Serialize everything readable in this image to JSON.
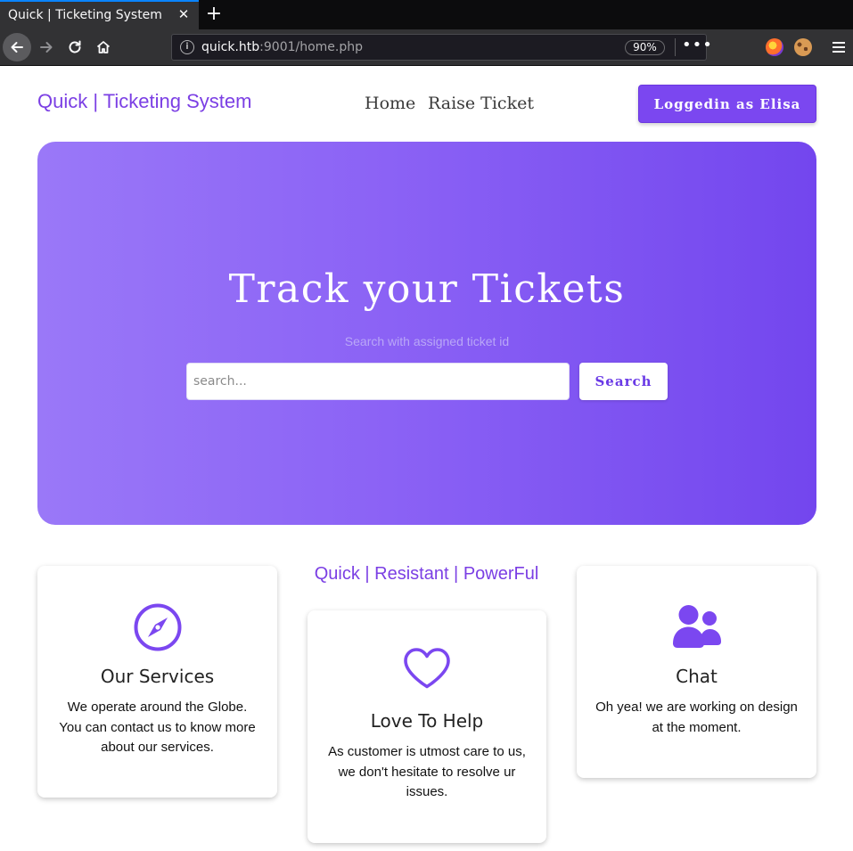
{
  "browser": {
    "tab_title": "Quick | Ticketing System",
    "tab_close": "✕",
    "new_tab": "+",
    "url_host": "quick.htb",
    "url_rest": ":9001/home.php",
    "zoom": "90%",
    "more": "•••",
    "info": "i"
  },
  "site": {
    "brand": "Quick | Ticketing System",
    "nav": {
      "home": "Home",
      "raise_ticket": "Raise Ticket"
    },
    "login_label": "Loggedin as Elisa",
    "accent_color": "#7b47f0"
  },
  "hero": {
    "title": "Track your Tickets",
    "subtitle": "Search with assigned ticket id",
    "search_placeholder": "search...",
    "search_value": "",
    "search_button": "Search"
  },
  "tagline": "Quick | Resistant | PowerFul",
  "cards": [
    {
      "icon": "compass-icon",
      "title": "Our Services",
      "text": "We operate around the Globe. You can contact us to know more about our services."
    },
    {
      "icon": "heart-icon",
      "title": "Love To Help",
      "text": "As customer is utmost care to us, we don't hesitate to resolve ur issues."
    },
    {
      "icon": "users-icon",
      "title": "Chat",
      "text": "Oh yea! we are working on design at the moment."
    }
  ]
}
